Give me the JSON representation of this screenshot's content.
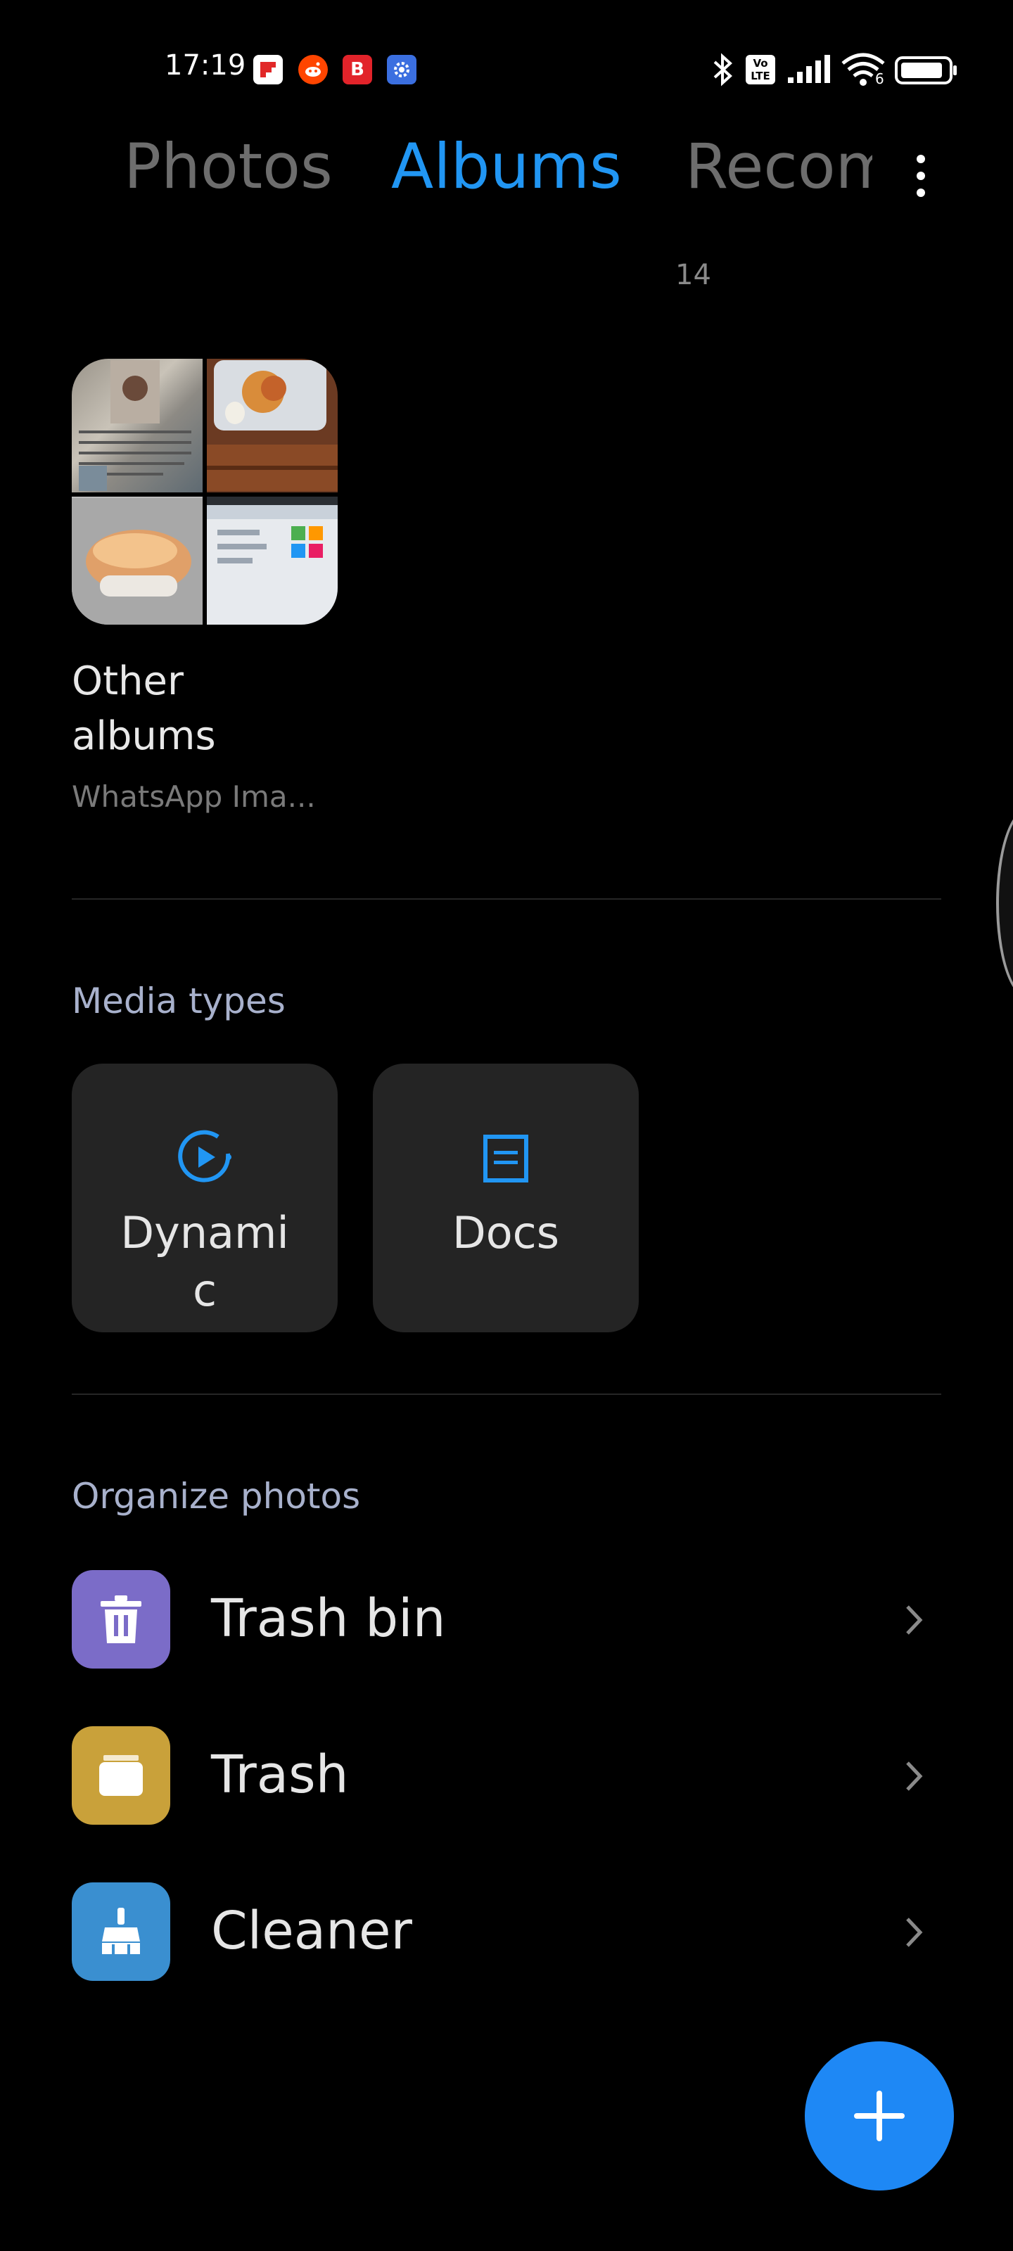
{
  "status_bar": {
    "time": "17:19",
    "notifications": [
      "flipboard-icon",
      "reddit-icon",
      "b-app-icon",
      "settings-app-icon"
    ],
    "right_icons": [
      "bluetooth-icon",
      "volte-icon",
      "signal-icon",
      "wifi-icon",
      "battery-icon"
    ],
    "volte_label": "Vo LTE",
    "wifi_badge": "6"
  },
  "tabs": {
    "photos": "Photos",
    "albums": "Albums",
    "recommended": "Recommended",
    "active": "Albums",
    "count": "14"
  },
  "albums": [
    {
      "title": "Other albums",
      "subtitle": "WhatsApp Ima...",
      "thumbnails": [
        "document-photo",
        "food-plate-photo",
        "bread-photo",
        "screen-photo"
      ]
    }
  ],
  "media_types": {
    "header": "Media types",
    "items": [
      {
        "label": "Dynami c",
        "icon": "play-circle-icon"
      },
      {
        "label": "Docs",
        "icon": "document-icon"
      }
    ]
  },
  "organize": {
    "header": "Organize photos",
    "items": [
      {
        "label": "Trash bin",
        "icon": "trash-bin-icon",
        "color": "#7b6cc8"
      },
      {
        "label": "Trash",
        "icon": "trash-icon",
        "color": "#c9a13a"
      },
      {
        "label": "Cleaner",
        "icon": "broom-icon",
        "color": "#3a8fd0"
      }
    ]
  },
  "colors": {
    "accent": "#2196f3",
    "fab": "#1e88f5"
  }
}
